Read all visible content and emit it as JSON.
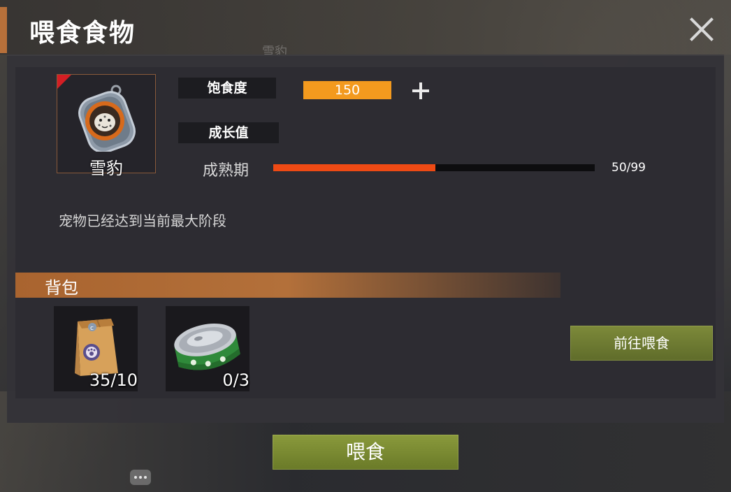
{
  "dialog": {
    "title": "喂食食物",
    "background_text": "雪豹"
  },
  "pet": {
    "name": "雪豹",
    "icon": "dog-tag-snow-leopard-icon"
  },
  "stats": {
    "satiety_label": "饱食度",
    "satiety_value": "150",
    "growth_label": "成长值",
    "stage_label": "成熟期",
    "growth_current": 50,
    "growth_max": 99,
    "growth_text": "50/99"
  },
  "info_text": "宠物已经达到当前最大阶段",
  "backpack": {
    "title": "背包",
    "items": [
      {
        "name": "pet-food-bag-icon",
        "count": "35/10"
      },
      {
        "name": "pet-food-can-icon",
        "count": "0/3"
      }
    ]
  },
  "buttons": {
    "goto_feed": "前往喂食",
    "feed": "喂食"
  },
  "colors": {
    "accent": "#b7703a",
    "satiety": "#f39a1e",
    "growth": "#ee4a14",
    "button_green": "#7d8a3a",
    "corner_red": "#d41e24"
  }
}
